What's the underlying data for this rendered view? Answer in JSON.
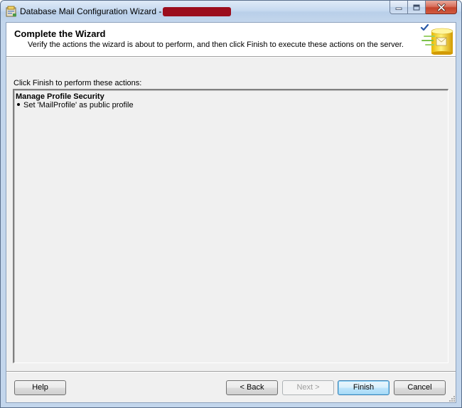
{
  "window": {
    "title": "Database Mail Configuration Wizard -"
  },
  "header": {
    "title": "Complete the Wizard",
    "subtitle": "Verify the actions the wizard is about to perform, and then click Finish to execute these actions on the server."
  },
  "content": {
    "section_label": "Click Finish to perform these actions:",
    "actions": [
      {
        "title": "Manage Profile Security",
        "items": [
          "Set 'MailProfile' as public profile"
        ]
      }
    ]
  },
  "buttons": {
    "help": "Help",
    "back": "< Back",
    "next": "Next >",
    "finish": "Finish",
    "cancel": "Cancel"
  },
  "colors": {
    "redaction": "#9b0d1c",
    "default_button_border": "#3c7fb1"
  },
  "icons": {
    "app": "wizard-app-icon",
    "header": "database-mail-icon"
  }
}
